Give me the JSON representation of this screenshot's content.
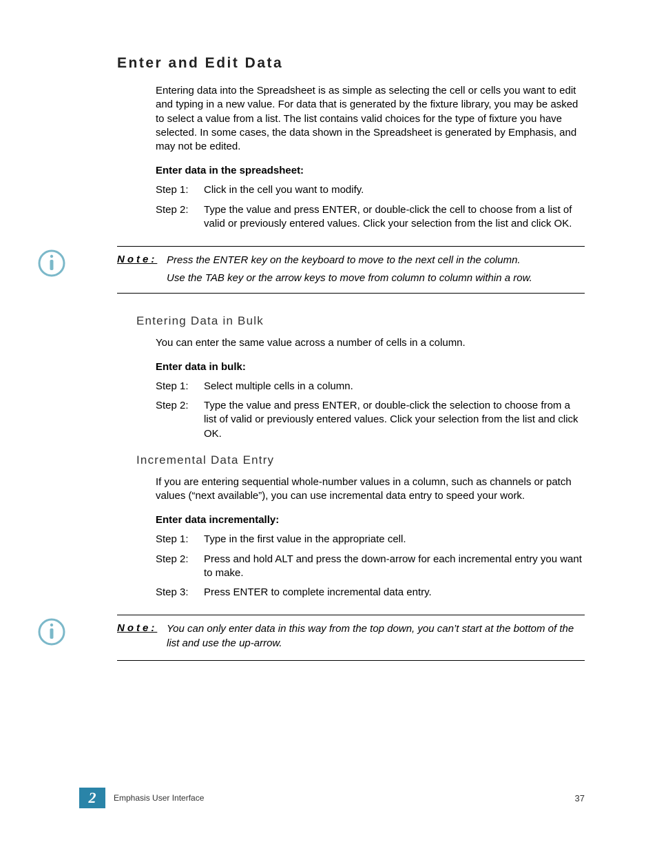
{
  "heading": "Enter and Edit Data",
  "intro": "Entering data into the Spreadsheet is as simple as selecting the cell or cells you want to edit and typing in a new value. For data that is generated by the fixture library, you may be asked to select a value from a list. The list contains valid choices for the type of fixture you have selected. In some cases, the data shown in the Spreadsheet is generated by Emphasis, and may not be edited.",
  "section1": {
    "title": "Enter data in the spreadsheet:",
    "steps": [
      {
        "label": "Step 1:",
        "text": "Click in the cell you want to modify."
      },
      {
        "label": "Step 2:",
        "text": "Type the value and press ENTER, or double-click the cell to choose from a list of valid or previously entered values. Click your selection from the list and click OK."
      }
    ]
  },
  "note1": {
    "label": "Note:",
    "line1": "Press the ENTER key on the keyboard to move to the next cell in the column.",
    "line2": "Use the TAB key or the arrow keys to move from column to column within a row."
  },
  "bulk": {
    "heading": "Entering Data in Bulk",
    "intro": "You can enter the same value across a number of cells in a column.",
    "title": "Enter data in bulk:",
    "steps": [
      {
        "label": "Step 1:",
        "text": "Select multiple cells in a column."
      },
      {
        "label": "Step 2:",
        "text": "Type the value and press ENTER, or double-click the selection to choose from a list of valid or previously entered values. Click your selection from the list and click OK."
      }
    ]
  },
  "incr": {
    "heading": "Incremental Data Entry",
    "intro": "If you are entering sequential whole-number values in a column, such as channels or patch values (“next available”), you can use incremental data entry to speed your work.",
    "title": "Enter data incrementally:",
    "steps": [
      {
        "label": "Step 1:",
        "text": "Type in the first value in the appropriate cell."
      },
      {
        "label": "Step 2:",
        "text": "Press and hold ALT and press the down-arrow for each incremental entry you want to make."
      },
      {
        "label": "Step 3:",
        "text": "Press ENTER to complete incremental data entry."
      }
    ]
  },
  "note2": {
    "label": "Note:",
    "text": "You can only enter data in this way from the top down, you can’t start at the bottom of the list and use the up-arrow."
  },
  "footer": {
    "chapter": "2",
    "title": "Emphasis User Interface",
    "page": "37"
  }
}
